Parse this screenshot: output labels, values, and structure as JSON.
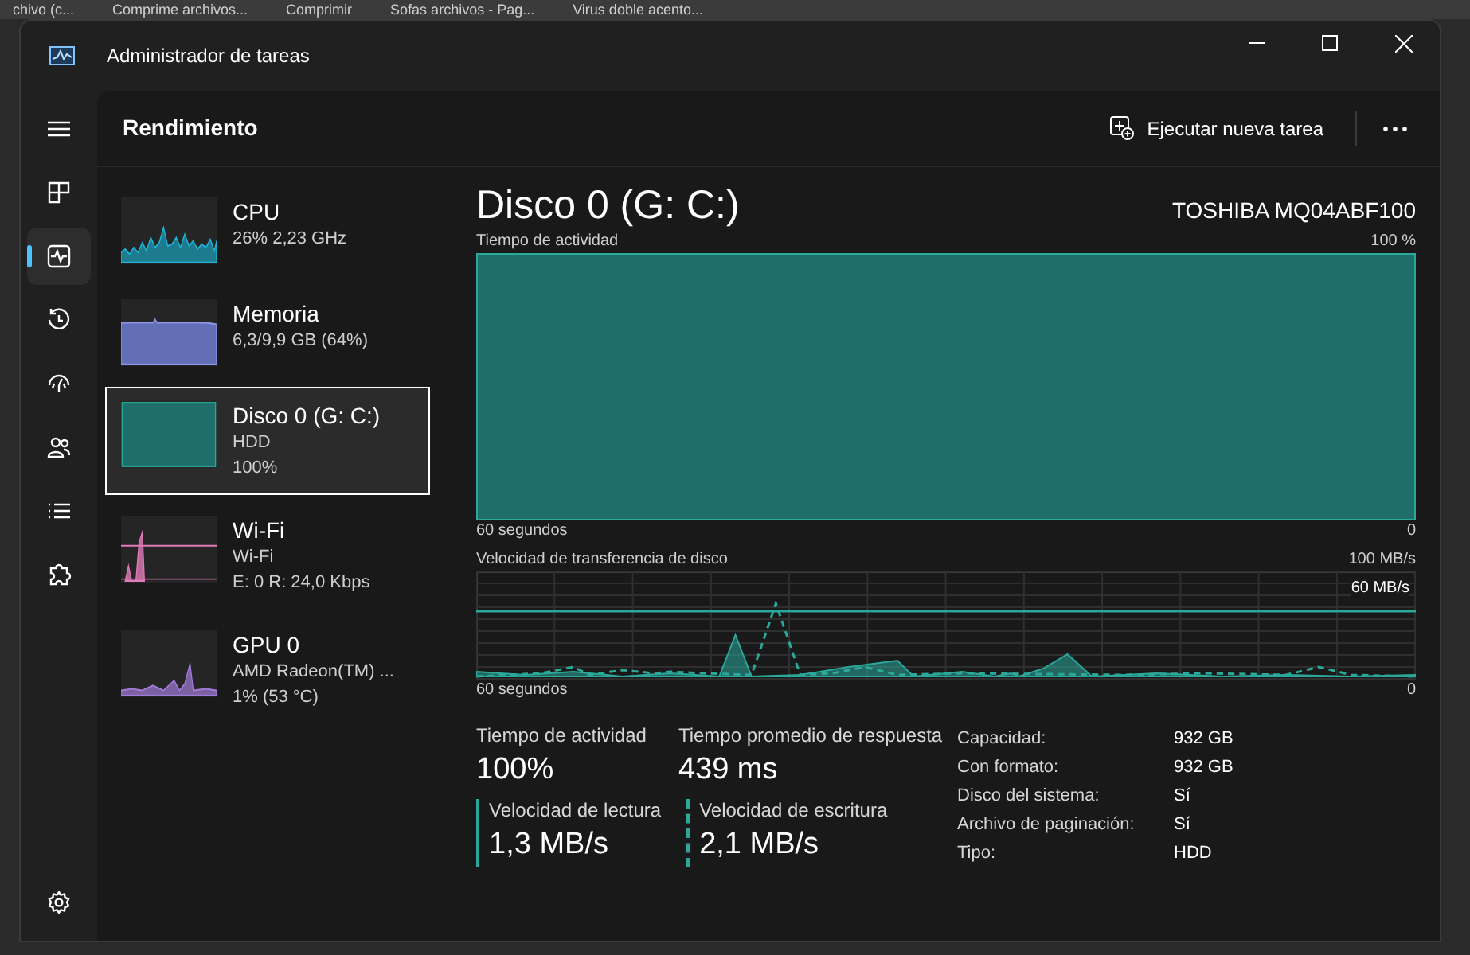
{
  "background_tabs": [
    "chivo (c...",
    "Comprime archivos...",
    "Comprimir",
    "Sofas archivos - Pag...",
    "Virus doble acento..."
  ],
  "window": {
    "title": "Administrador de tareas"
  },
  "nav": [
    {
      "kind": "menu",
      "selected": false
    },
    {
      "kind": "processes",
      "selected": false
    },
    {
      "kind": "performance",
      "selected": true
    },
    {
      "kind": "history",
      "selected": false
    },
    {
      "kind": "startup",
      "selected": false
    },
    {
      "kind": "users",
      "selected": false
    },
    {
      "kind": "details",
      "selected": false
    },
    {
      "kind": "services",
      "selected": false
    },
    {
      "kind": "settings",
      "selected": false
    }
  ],
  "header": {
    "title": "Rendimiento",
    "run_task": "Ejecutar nueva tarea"
  },
  "devices": [
    {
      "kind": "cpu",
      "name": "CPU",
      "lines": [
        "26%  2,23 GHz"
      ],
      "selected": false
    },
    {
      "kind": "memory",
      "name": "Memoria",
      "lines": [
        "6,3/9,9 GB (64%)"
      ],
      "selected": false
    },
    {
      "kind": "disk",
      "name": "Disco 0 (G: C:)",
      "lines": [
        "HDD",
        "100%"
      ],
      "selected": true
    },
    {
      "kind": "wifi",
      "name": "Wi-Fi",
      "lines": [
        "Wi-Fi",
        "E: 0 R: 24,0 Kbps"
      ],
      "selected": false
    },
    {
      "kind": "gpu",
      "name": "GPU 0",
      "lines": [
        "AMD Radeon(TM) ...",
        "1%  (53 °C)"
      ],
      "selected": false
    }
  ],
  "detail": {
    "title": "Disco 0 (G: C:)",
    "model": "TOSHIBA MQ04ABF100",
    "activity_chart": {
      "label": "Tiempo de actividad",
      "max": "100 %",
      "time": "60 segundos",
      "min": "0"
    },
    "transfer_chart": {
      "label": "Velocidad de transferencia de disco",
      "max": "100 MB/s",
      "marker": "60 MB/s",
      "time": "60 segundos",
      "min": "0"
    },
    "stats": [
      {
        "label": "Tiempo de actividad",
        "value": "100%"
      },
      {
        "label": "Tiempo promedio de respuesta",
        "value": "439 ms"
      }
    ],
    "speeds": [
      {
        "kind": "read",
        "label": "Velocidad de lectura",
        "value": "1,3 MB/s"
      },
      {
        "kind": "write",
        "label": "Velocidad de escritura",
        "value": "2,1 MB/s"
      }
    ],
    "properties": [
      {
        "label": "Capacidad:",
        "value": "932 GB"
      },
      {
        "label": "Con formato:",
        "value": "932 GB"
      },
      {
        "label": "Disco del sistema:",
        "value": "Sí"
      },
      {
        "label": "Archivo de paginación:",
        "value": "Sí"
      },
      {
        "label": "Tipo:",
        "value": "HDD"
      }
    ]
  }
}
